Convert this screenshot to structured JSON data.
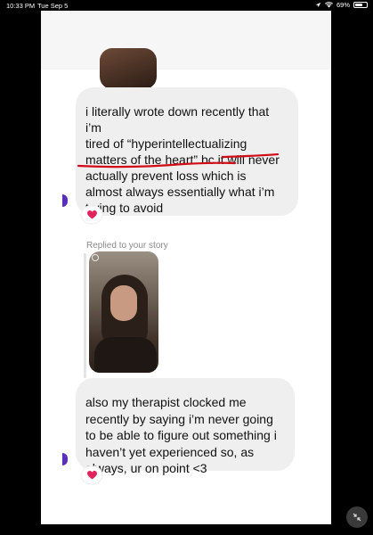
{
  "status_bar": {
    "time": "10:33 PM",
    "date": "Tue Sep 5",
    "battery_percent": "69%",
    "battery_level": 0.69
  },
  "messages": [
    {
      "lines": [
        "i literally wrote down recently that",
        "i’m",
        "tired of “hyperintellectualizing",
        "matters of the heart” bc it will never",
        "actually prevent loss which is",
        "almost always essentially what i’m",
        "trying to avoid"
      ],
      "reaction": "heart-emoji"
    },
    {
      "replied_label": "Replied to your story",
      "lines": [
        "also my therapist clocked me",
        "recently by saying i’m never going",
        "to be able to figure out something i",
        "haven’t yet experienced so, as",
        "always, ur on point <3"
      ],
      "reaction": "heart-emoji"
    }
  ],
  "colors": {
    "bubble": "#efefef",
    "underline": "#d20d17",
    "heart": "#e0245e",
    "accent": "#5b2fb8"
  }
}
